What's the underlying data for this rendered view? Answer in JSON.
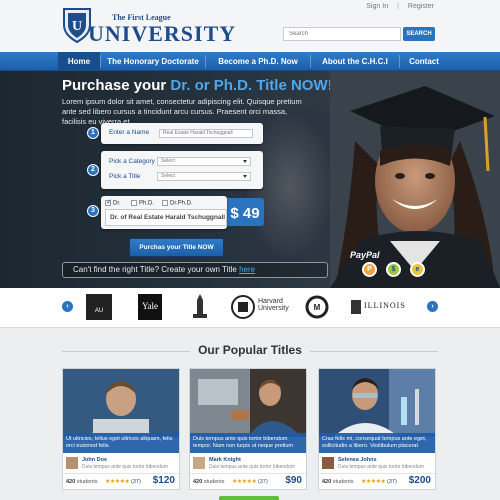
{
  "header": {
    "logo_small": "The First League",
    "logo_big": "UNIVERSITY",
    "sign_in": "Sign In",
    "register": "Register",
    "search_placeholder": "Search",
    "search_button": "SEARCH"
  },
  "nav": {
    "items": [
      "Home",
      "The Honorary Doctorate",
      "Become a Ph.D. Now",
      "About the C.H.C.I",
      "Contact"
    ],
    "active": "Home"
  },
  "hero": {
    "title_pre": "Purchase your",
    "title_highlight": "Dr. or Ph.D. Title NOW!",
    "lead": "Lorem ipsum dolor sit amet, consectetur adipiscing elit. Quisque pretium ante sed libero cursus a tincidunt arcu cursus. Praesent orci massa, facilisis eu viverra et.",
    "step1": {
      "num": "1",
      "label": "Enter a Name",
      "value": "Real Estate Harald Tschuggnall"
    },
    "step2": {
      "num": "2",
      "category_label": "Pick a Category",
      "category_value": "Select",
      "title_label": "Pick a Title",
      "title_value": "Select"
    },
    "step3": {
      "num": "3",
      "options": [
        "Dr.",
        "Ph.D.",
        "Dr.Ph.D."
      ],
      "checked": "Dr.",
      "preview": "Dr. of Real Estate Harald Tschuggnall",
      "price": "$ 49"
    },
    "buy_button": "Purchas your Title NOW",
    "create_text": "Can't find the right Title? Create your own Title",
    "create_link": "here",
    "paypal": "PayPal"
  },
  "universities": [
    {
      "name": "AMERICAN UNIVERSITY"
    },
    {
      "name": "Yale"
    },
    {
      "name": "HOWARD UNIVERSITY"
    },
    {
      "name": "Harvard University"
    },
    {
      "name": "UNIVERSITY"
    },
    {
      "name": "ILLINOIS"
    }
  ],
  "popular": {
    "title": "Our Popular Titles",
    "courses": [
      {
        "desc": "Ut ultricies, tellus eget ultrices aliquam, felis orci euismod felis.",
        "author": "John Doe",
        "author_text": "Duis tempus ante quis tortor bibendum",
        "students": "420",
        "students_label": "students",
        "stars": "★★★★★",
        "reviews": "(37)",
        "price": "$120"
      },
      {
        "desc": "Duis tempus ante quis tortor bibendum tempor. Nam non turpis ut neque pretium",
        "author": "Mark Knight",
        "author_text": "Duis tempus ante quis tortor bibendum",
        "students": "420",
        "students_label": "students",
        "stars": "★★★★★",
        "reviews": "(37)",
        "price": "$90"
      },
      {
        "desc": "Cras felis mi, consequat tempus ante eget, sollicitudin a libero. Vestibulum placerat",
        "author": "Selenea Johns",
        "author_text": "Duis tempus ante quis tortor bibendum",
        "students": "420",
        "students_label": "students",
        "stars": "★★★★★",
        "reviews": "(37)",
        "price": "$200"
      }
    ]
  },
  "colors": {
    "brand": "#1d4d8c",
    "accent": "#2a73bf",
    "highlight": "#4ea7ee",
    "star": "#e3a317"
  }
}
